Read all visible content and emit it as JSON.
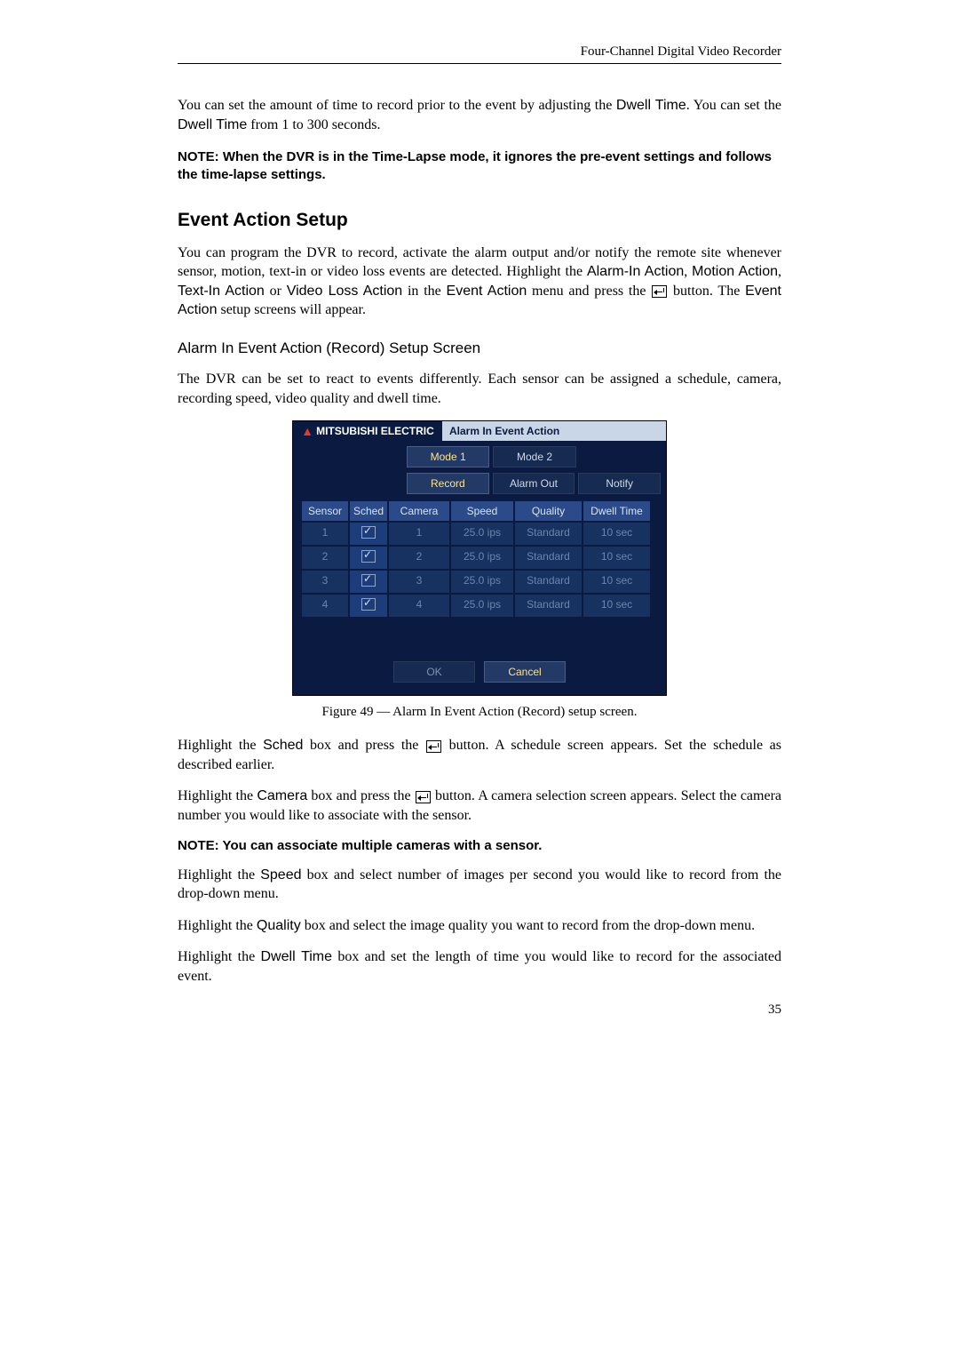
{
  "header": {
    "doc_title": "Four-Channel Digital Video Recorder"
  },
  "intro": {
    "p1_a": "You can set the amount of time to record prior to the event by adjusting the ",
    "p1_b": "Dwell Time",
    "p1_c": ".  You can set the ",
    "p1_d": "Dwell Time",
    "p1_e": " from 1 to 300 seconds."
  },
  "note1": "NOTE:  When the DVR is in the Time-Lapse mode, it ignores the pre-event settings and follows the time-lapse settings.",
  "section_title": "Event Action Setup",
  "para_event_a": "You can program the DVR to record, activate the alarm output and/or notify the remote site whenever sensor, motion, text-in or video loss events are detected.  Highlight the ",
  "evt_labels": {
    "alarm_in": "Alarm-In Action",
    "motion": "Motion Action",
    "textin": "Text-In Action",
    "videoloss": "Video Loss Action",
    "event_action_menu": "Event Action",
    "event_action_word": "Event Action"
  },
  "para_event_b": " or ",
  "para_event_c": " in the ",
  "para_event_d": " menu and press the ",
  "para_event_e": " button.  The ",
  "para_event_f": " setup screens will appear.",
  "subsection_title": "Alarm In Event Action (Record) Setup Screen",
  "para_desc": "The DVR can be set to react to events differently.  Each sensor can be assigned a schedule, camera, recording speed, video quality and dwell time.",
  "dvr": {
    "brand": "MITSUBISHI ELECTRIC",
    "window_title": "Alarm In Event Action",
    "mode1": "Mode 1",
    "mode2": "Mode 2",
    "tab_record": "Record",
    "tab_alarmout": "Alarm Out",
    "tab_notify": "Notify",
    "headers": {
      "sensor": "Sensor",
      "sched": "Sched",
      "camera": "Camera",
      "speed": "Speed",
      "quality": "Quality",
      "dwell": "Dwell Time"
    },
    "rows": [
      {
        "sensor": "1",
        "camera": "1",
        "speed": "25.0 ips",
        "quality": "Standard",
        "dwell": "10 sec"
      },
      {
        "sensor": "2",
        "camera": "2",
        "speed": "25.0 ips",
        "quality": "Standard",
        "dwell": "10 sec"
      },
      {
        "sensor": "3",
        "camera": "3",
        "speed": "25.0 ips",
        "quality": "Standard",
        "dwell": "10 sec"
      },
      {
        "sensor": "4",
        "camera": "4",
        "speed": "25.0 ips",
        "quality": "Standard",
        "dwell": "10 sec"
      }
    ],
    "ok": "OK",
    "cancel": "Cancel"
  },
  "figure_caption": "Figure 49 — Alarm In Event Action (Record) setup screen.",
  "sched_a": "Highlight the ",
  "sched_lbl": "Sched",
  "sched_b": " box and press the ",
  "sched_c": " button.  A schedule screen appears.  Set the schedule as described earlier.",
  "cam_a": "Highlight the ",
  "cam_lbl": "Camera",
  "cam_b": " box and press the ",
  "cam_c": " button.  A camera selection screen appears.  Select the camera number you would like to associate with the sensor.",
  "note2": "NOTE:  You can associate multiple cameras with a sensor.",
  "speed_a": "Highlight the ",
  "speed_lbl": "Speed",
  "speed_b": " box and select number of images per second you would like to record from the drop-down menu.",
  "qual_a": "Highlight the ",
  "qual_lbl": "Quality",
  "qual_b": " box and select the image quality you want to record from the drop-down menu.",
  "dwell_a": "Highlight the ",
  "dwell_lbl": "Dwell Time",
  "dwell_b": " box and set the length of time you would like to record for the associated event.",
  "page_number": "35"
}
